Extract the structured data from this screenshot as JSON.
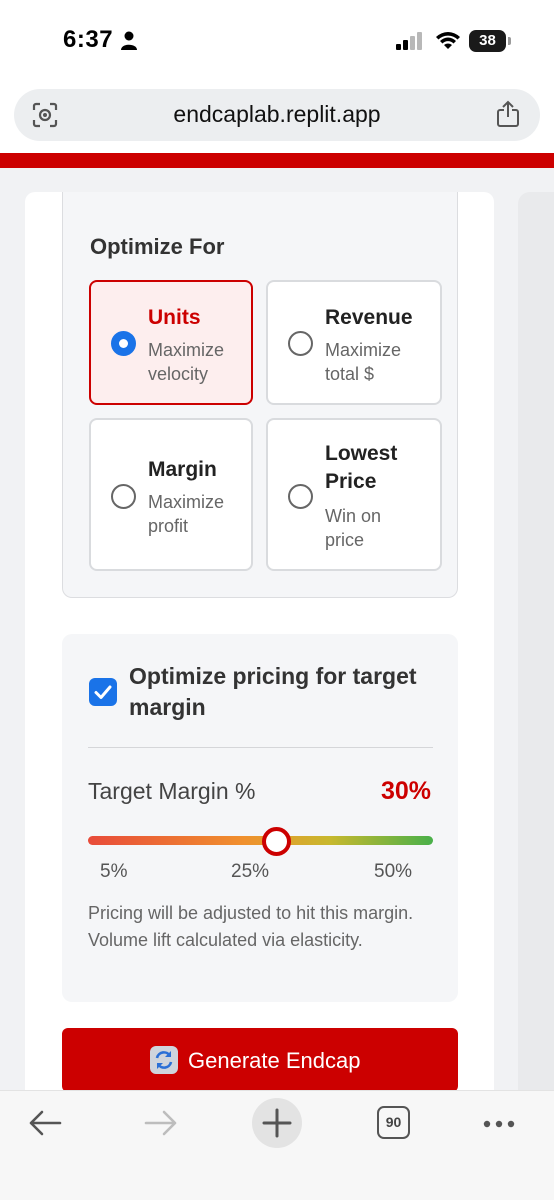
{
  "status_bar": {
    "time": "6:37",
    "battery": "38"
  },
  "browser": {
    "url": "endcaplab.replit.app",
    "tab_count": "90"
  },
  "optimize": {
    "title": "Optimize For",
    "options": [
      {
        "title": "Units",
        "desc": "Maximize velocity",
        "selected": true
      },
      {
        "title": "Revenue",
        "desc": "Maximize total $",
        "selected": false
      },
      {
        "title": "Margin",
        "desc": "Maximize profit",
        "selected": false
      },
      {
        "title": "Lowest Price",
        "desc": "Win on price",
        "selected": false
      }
    ]
  },
  "margin": {
    "checkbox_label": "Optimize pricing for target margin",
    "checked": true,
    "target_label": "Target Margin %",
    "target_value": "30%",
    "slider_value_percent": 30,
    "slider_min": "5%",
    "slider_mid": "25%",
    "slider_max": "50%",
    "note": "Pricing will be adjusted to hit this margin. Volume lift calculated via elasticity."
  },
  "actions": {
    "generate_label": "Generate Endcap"
  },
  "colors": {
    "accent": "#cc0000",
    "selection_blue": "#1a73e8"
  }
}
